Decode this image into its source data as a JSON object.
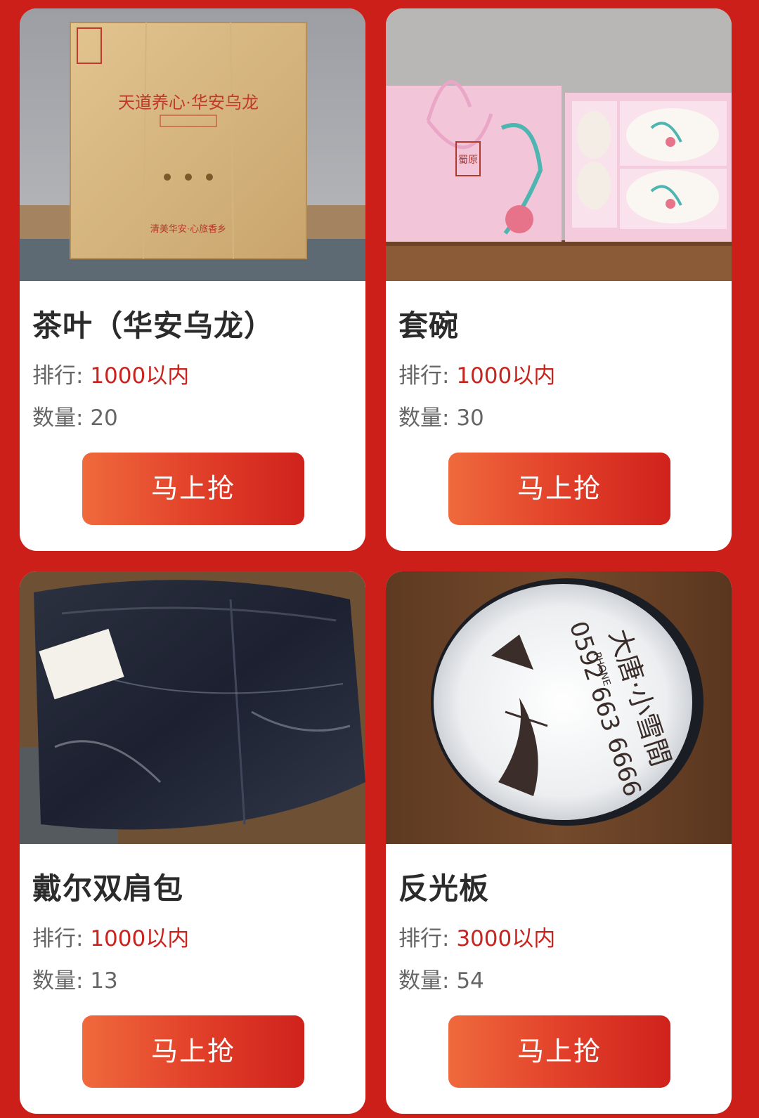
{
  "labels": {
    "rank_prefix": "排行:",
    "qty_prefix": "数量:"
  },
  "products": [
    {
      "title": "茶叶（华安乌龙）",
      "rank": "1000以内",
      "quantity": "20",
      "button": "马上抢",
      "image": {
        "box_line1": "天道养心·华安乌龙",
        "box_line2": "清美华安·心旅香乡"
      }
    },
    {
      "title": "套碗",
      "rank": "1000以内",
      "quantity": "30",
      "button": "马上抢",
      "image": {
        "brand": "蜀原"
      }
    },
    {
      "title": "戴尔双肩包",
      "rank": "1000以内",
      "quantity": "13",
      "button": "马上抢",
      "image": {}
    },
    {
      "title": "反光板",
      "rank": "3000以内",
      "quantity": "54",
      "button": "马上抢",
      "image": {
        "brand": "大唐·小雪間",
        "phone_label": "PHONE",
        "phone": "0592 663 6666"
      }
    }
  ],
  "colors": {
    "background": "#cc1f1a",
    "accent_text": "#c8231d",
    "button_gradient_start": "#ef6a3c",
    "button_gradient_end": "#cf221c"
  }
}
